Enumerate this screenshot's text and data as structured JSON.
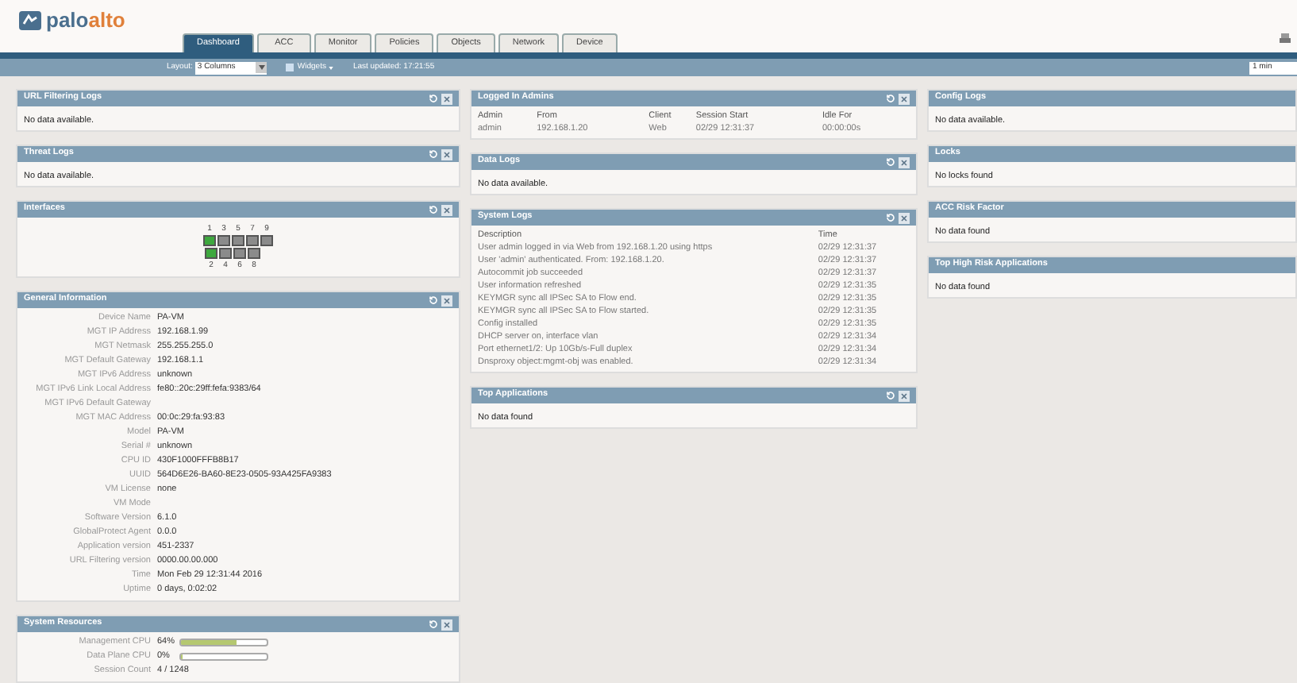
{
  "logo": {
    "text": "palo",
    "accent": "alto"
  },
  "tabs": [
    {
      "label": "Dashboard",
      "selected": true
    },
    {
      "label": "ACC",
      "selected": false
    },
    {
      "label": "Monitor",
      "selected": false
    },
    {
      "label": "Policies",
      "selected": false
    },
    {
      "label": "Objects",
      "selected": false
    },
    {
      "label": "Network",
      "selected": false
    },
    {
      "label": "Device",
      "selected": false
    }
  ],
  "toolbar": {
    "layout_label": "Layout:",
    "layout_value": "3 Columns",
    "widgets_label": "Widgets",
    "last_updated": "Last updated: 17:21:55",
    "refresh_value": "1 min"
  },
  "columns": [
    {
      "widgets": [
        {
          "kind": "message",
          "title": "URL Filtering Logs",
          "controls": true,
          "message": "No data available."
        },
        {
          "kind": "message",
          "title": "Threat Logs",
          "controls": true,
          "message": "No data available."
        },
        {
          "kind": "interfaces",
          "title": "Interfaces",
          "controls": true,
          "top": [
            {
              "label": "1",
              "up": true
            },
            {
              "label": "3",
              "up": false
            },
            {
              "label": "5",
              "up": false
            },
            {
              "label": "7",
              "up": false
            },
            {
              "label": "9",
              "up": false
            }
          ],
          "bottom": [
            {
              "label": "2",
              "up": true
            },
            {
              "label": "4",
              "up": false
            },
            {
              "label": "6",
              "up": false
            },
            {
              "label": "8",
              "up": false
            }
          ]
        },
        {
          "kind": "info",
          "title": "General Information",
          "controls": true,
          "rows": [
            {
              "label": "Device Name",
              "value": "PA-VM"
            },
            {
              "label": "MGT IP Address",
              "value": "192.168.1.99"
            },
            {
              "label": "MGT Netmask",
              "value": "255.255.255.0"
            },
            {
              "label": "MGT Default Gateway",
              "value": "192.168.1.1"
            },
            {
              "label": "MGT IPv6 Address",
              "value": "unknown"
            },
            {
              "label": "MGT IPv6 Link Local Address",
              "value": "fe80::20c:29ff:fefa:9383/64"
            },
            {
              "label": "MGT IPv6 Default Gateway"
            },
            {
              "label": "MGT MAC Address",
              "value": "00:0c:29:fa:93:83"
            },
            {
              "label": "Model",
              "value": "PA-VM"
            },
            {
              "label": "Serial #",
              "value": "unknown"
            },
            {
              "label": "CPU ID",
              "value": "430F1000FFFB8B17"
            },
            {
              "label": "UUID",
              "value": "564D6E26-BA60-8E23-0505-93A425FA9383"
            },
            {
              "label": "VM License",
              "value": "none"
            },
            {
              "label": "VM Mode"
            },
            {
              "label": "Software Version",
              "value": "6.1.0"
            },
            {
              "label": "GlobalProtect Agent",
              "value": "0.0.0"
            },
            {
              "label": "Application version",
              "value": "451-2337"
            },
            {
              "label": "URL Filtering version",
              "value": "0000.00.00.000"
            },
            {
              "label": "Time",
              "value": "Mon Feb 29 12:31:44 2016"
            },
            {
              "label": "Uptime",
              "value": "0 days, 0:02:02"
            }
          ]
        },
        {
          "kind": "resources",
          "title": "System Resources",
          "controls": true,
          "rows": [
            {
              "label": "Management CPU",
              "value": "64%",
              "level": 0.64
            },
            {
              "label": "Data Plane CPU",
              "value": "0%",
              "level": 0
            },
            {
              "label": "Session Count",
              "value": "4 / 1248"
            }
          ]
        }
      ]
    },
    {
      "widgets": [
        {
          "kind": "table",
          "title": "Logged In Admins",
          "controls": true,
          "columns": [
            "Admin",
            "From",
            "Client",
            "Session Start",
            "Idle For"
          ],
          "rows": [
            [
              "admin",
              "192.168.1.20",
              "Web",
              "02/29 12:31:37",
              "00:00:00s"
            ]
          ]
        },
        {
          "kind": "message",
          "title": "Data Logs",
          "controls": true,
          "message": "No data available."
        },
        {
          "kind": "table",
          "title": "System Logs",
          "controls": true,
          "columns": [
            "Description",
            "Time"
          ],
          "rows": [
            [
              "User admin logged in via Web from 192.168.1.20 using https",
              "02/29 12:31:37"
            ],
            [
              "User 'admin' authenticated. From: 192.168.1.20.",
              "02/29 12:31:37"
            ],
            [
              "Autocommit job succeeded",
              "02/29 12:31:37"
            ],
            [
              "User information refreshed",
              "02/29 12:31:35"
            ],
            [
              "KEYMGR sync all IPSec SA to Flow end.",
              "02/29 12:31:35"
            ],
            [
              "KEYMGR sync all IPSec SA to Flow started.",
              "02/29 12:31:35"
            ],
            [
              "Config installed",
              "02/29 12:31:35"
            ],
            [
              "DHCP server on, interface vlan",
              "02/29 12:31:34"
            ],
            [
              "Port ethernet1/2: Up 10Gb/s-Full duplex",
              "02/29 12:31:34"
            ],
            [
              "Dnsproxy object:mgmt-obj was enabled.",
              "02/29 12:31:34"
            ]
          ]
        },
        {
          "kind": "message",
          "title": "Top Applications",
          "controls": true,
          "message": "No data found"
        }
      ]
    },
    {
      "widgets": [
        {
          "kind": "message",
          "title": "Config Logs",
          "controls": false,
          "message": "No data available."
        },
        {
          "kind": "message",
          "title": "Locks",
          "controls": false,
          "message": "No locks found"
        },
        {
          "kind": "message",
          "title": "ACC Risk Factor",
          "controls": false,
          "message": "No data found"
        },
        {
          "kind": "message",
          "title": "Top High Risk Applications",
          "controls": false,
          "message": "No data found"
        }
      ]
    }
  ]
}
